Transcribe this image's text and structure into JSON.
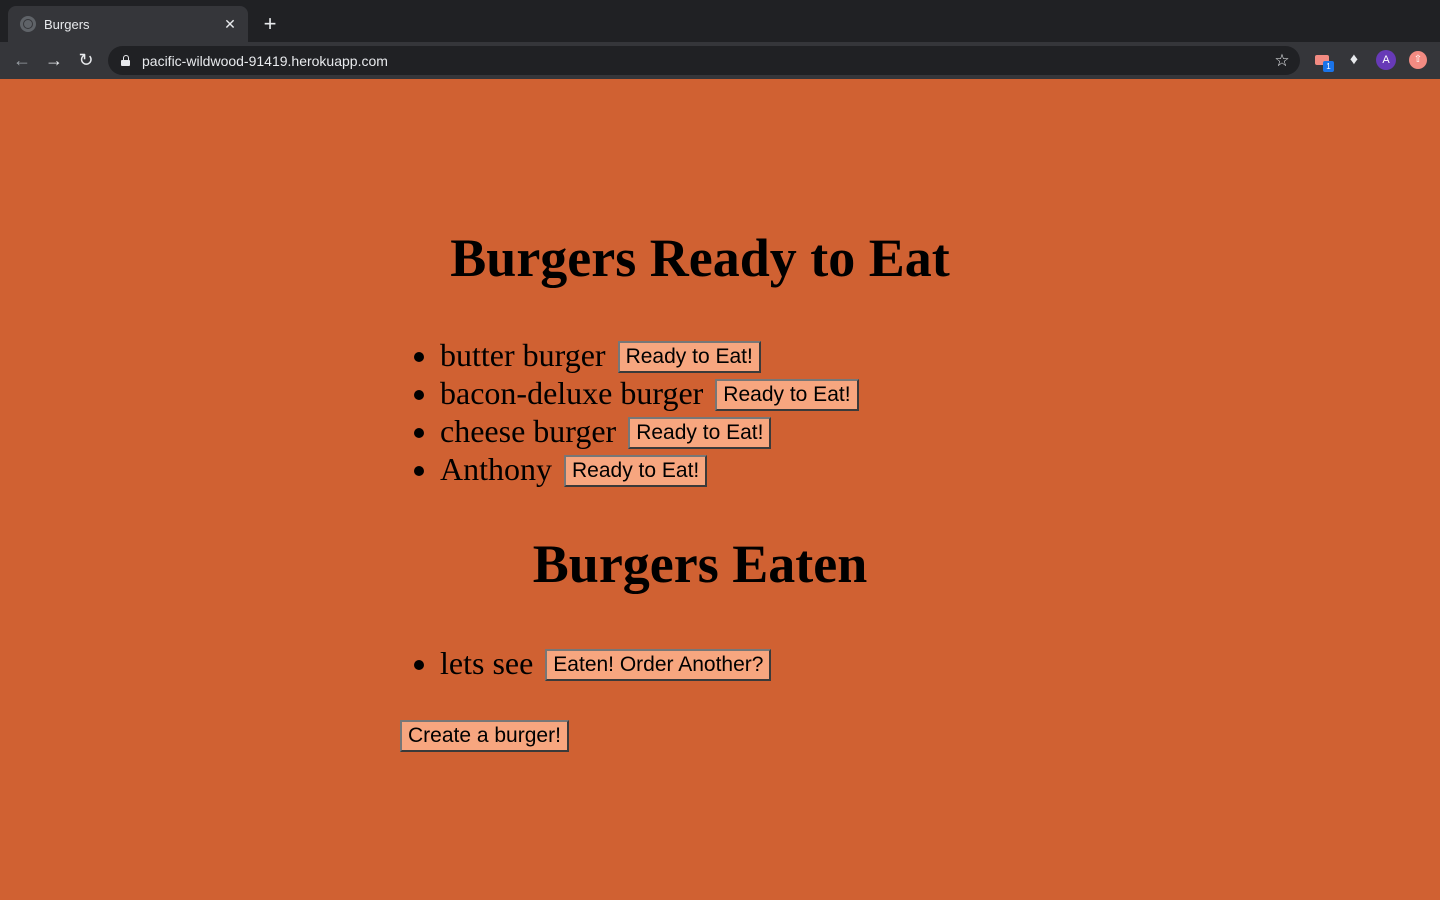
{
  "browser": {
    "tab_title": "Burgers",
    "tab_close": "✕",
    "new_tab": "+",
    "url": "pacific-wildwood-91419.herokuapp.com",
    "extension_badge": "1",
    "avatar_letter": "A"
  },
  "page": {
    "background": "#d06132",
    "ready_heading": "Burgers Ready to Eat",
    "ready_items": [
      {
        "name": "butter burger",
        "button": "Ready to Eat!"
      },
      {
        "name": "bacon-deluxe burger",
        "button": "Ready to Eat!"
      },
      {
        "name": "cheese burger",
        "button": "Ready to Eat!"
      },
      {
        "name": "Anthony",
        "button": "Ready to Eat!"
      }
    ],
    "eaten_heading": "Burgers Eaten",
    "eaten_items": [
      {
        "name": "lets see",
        "button": "Eaten! Order Another?"
      }
    ],
    "create_button": "Create a burger!"
  }
}
